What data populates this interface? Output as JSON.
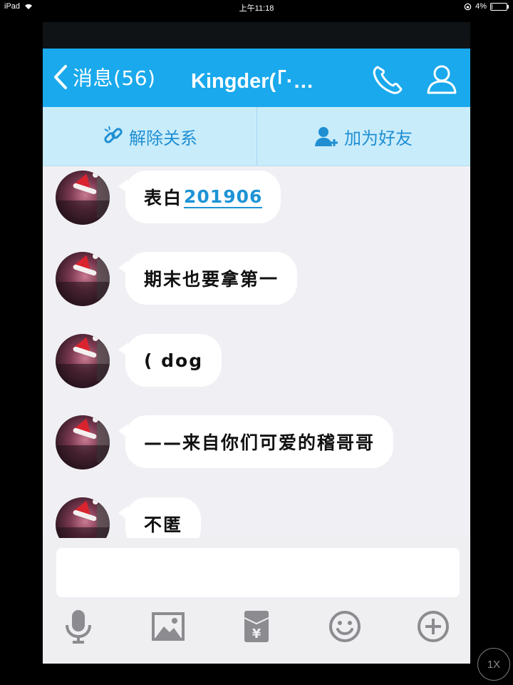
{
  "status_bar": {
    "device": "iPad",
    "time": "上午11:18",
    "battery": "4%",
    "battery_level": 0.04
  },
  "nav": {
    "back_label": "消息(56)",
    "title": "Kingder(「·…",
    "phone_icon": "phone-icon",
    "profile_icon": "person-icon"
  },
  "actions": {
    "unlink_label": "解除关系",
    "unlink_icon": "broken-link-icon",
    "add_friend_label": "加为好友",
    "add_friend_icon": "add-person-icon"
  },
  "messages": [
    {
      "text": "表白",
      "link": "201906"
    },
    {
      "text": "期末也要拿第一"
    },
    {
      "text": "( dog"
    },
    {
      "text": "——来自你们可爱的稽哥哥"
    },
    {
      "text": "不匿"
    }
  ],
  "input": {
    "placeholder": ""
  },
  "toolbar": {
    "icons": [
      "microphone-icon",
      "image-icon",
      "red-packet-icon",
      "emoji-icon",
      "plus-icon"
    ]
  },
  "zoom_badge": "1X",
  "colors": {
    "nav_blue": "#1aa9ec",
    "action_bar": "#c9ecfb",
    "action_text": "#1f8fd2",
    "link": "#1d93d6",
    "chat_bg": "#f0f0f4"
  }
}
